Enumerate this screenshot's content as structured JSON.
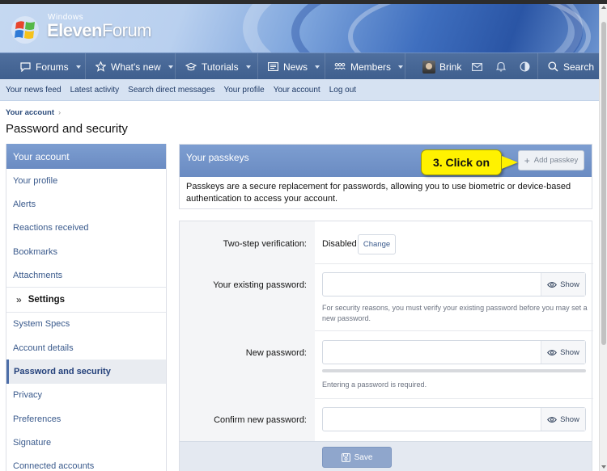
{
  "site": {
    "logo_small": "Windows",
    "logo_main": "Eleven",
    "logo_light": "Forum"
  },
  "nav": {
    "items": [
      {
        "label": "Forums",
        "icon": "forums-icon"
      },
      {
        "label": "What's new",
        "icon": "star-icon"
      },
      {
        "label": "Tutorials",
        "icon": "graduation-cap-icon"
      },
      {
        "label": "News",
        "icon": "newspaper-icon"
      },
      {
        "label": "Members",
        "icon": "members-icon"
      }
    ],
    "user": "Brink",
    "search": "Search"
  },
  "subnav": [
    "Your news feed",
    "Latest activity",
    "Search direct messages",
    "Your profile",
    "Your account",
    "Log out"
  ],
  "breadcrumb": "Your account",
  "page_title": "Password and security",
  "sidebar": {
    "header": "Your account",
    "items": [
      "Your profile",
      "Alerts",
      "Reactions received",
      "Bookmarks",
      "Attachments"
    ],
    "settings_heading": "Settings",
    "settings_items": [
      "System Specs",
      "Account details",
      "Password and security",
      "Privacy",
      "Preferences",
      "Signature",
      "Connected accounts"
    ],
    "active": "Password and security"
  },
  "passkeys": {
    "title": "Your passkeys",
    "add_button": "Add passkey",
    "description": "Passkeys are a secure replacement for passwords, allowing you to use biometric or device-based authentication to access your account."
  },
  "callout": "3. Click on",
  "form": {
    "two_step_label": "Two-step verification:",
    "two_step_status": "Disabled",
    "change_button": "Change",
    "existing_label": "Your existing password:",
    "existing_hint": "For security reasons, you must verify your existing password before you may set a new password.",
    "new_label": "New password:",
    "new_hint": "Entering a password is required.",
    "confirm_label": "Confirm new password:",
    "show_label": "Show",
    "save_button": "Save"
  },
  "colors": {
    "accent": "#6a8bc2",
    "nav": "#45659a",
    "callout": "#fff200"
  }
}
